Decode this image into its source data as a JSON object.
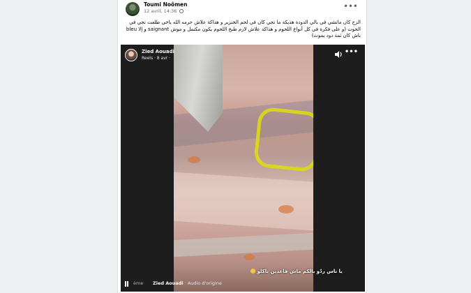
{
  "post": {
    "author": "Toumi Noômen",
    "date": "12 avril, 14:36",
    "more_label": "•••",
    "text": "الزح كان ماتشي في بالي الدودة هذيكة ما تجي كان في لحم الخنزير و هذاكة علاش حرمه الله ياخي طلعت تجي في الحوت (و على فكرة في كل أنواع اللحوم و هذاكة علاش لازم طبخ اللحوم يكون مكتمل و موش saignant و إلا bleu باش كان ثمة دود يموت)"
  },
  "reel": {
    "author": "Zied Aouadi",
    "meta": "Reels · 8 avr ·",
    "more_label": "•••",
    "caption": "يا ناس ردّو بالكم ماش قاعدين تاكلو",
    "bottom_author": "Zied Aouadi",
    "bottom_audio": " · Audio d'origine",
    "bottom_label": "ème"
  },
  "icons": {
    "globe": "globe-icon",
    "volume": "volume-icon",
    "pause": "pause-icon",
    "emoji": "grimace-emoji-icon"
  },
  "colors": {
    "highlight_ring": "#dcdc14",
    "video_bg": "#1d1d1d"
  }
}
